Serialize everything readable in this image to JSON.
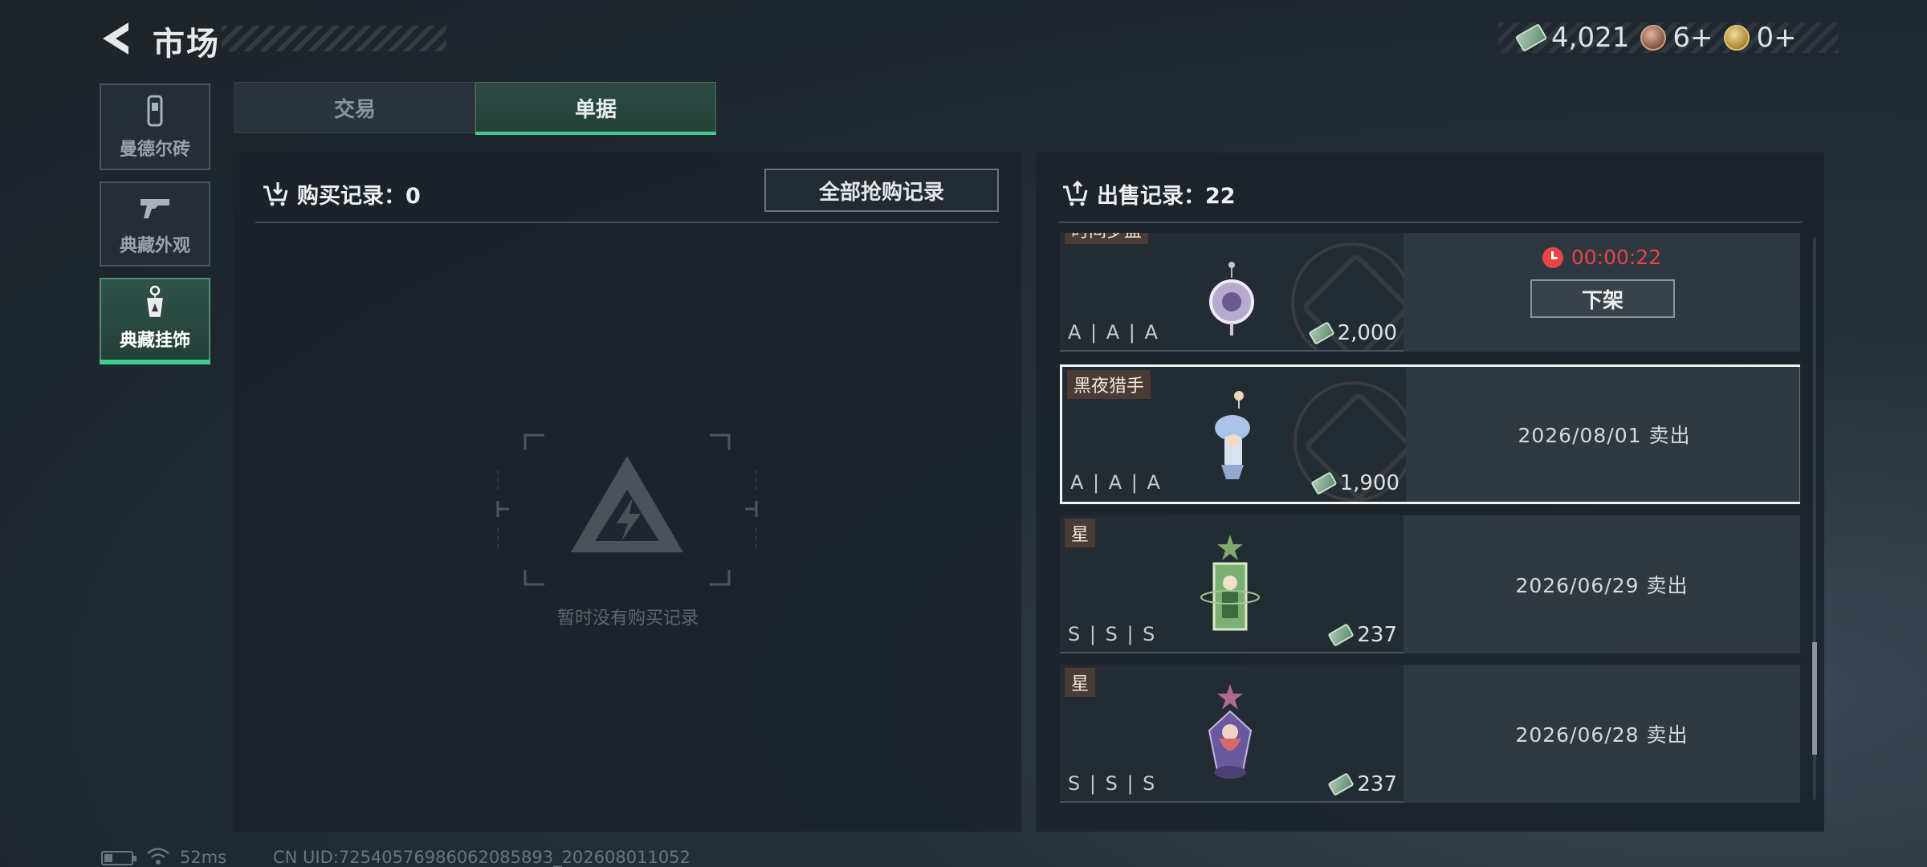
{
  "header": {
    "title": "市场",
    "currencies": [
      {
        "icon": "banknote-icon",
        "value": "4,021"
      },
      {
        "icon": "bronze-coin-icon",
        "value": "6+"
      },
      {
        "icon": "gold-coin-icon",
        "value": "0+"
      }
    ]
  },
  "sidebar": {
    "items": [
      {
        "label": "曼德尔砖",
        "icon": "mandel-brick-icon",
        "active": false
      },
      {
        "label": "典藏外观",
        "icon": "pistol-icon",
        "active": false
      },
      {
        "label": "典藏挂饰",
        "icon": "charm-icon",
        "active": true
      }
    ]
  },
  "tabs": [
    {
      "label": "交易",
      "active": false
    },
    {
      "label": "单据",
      "active": true
    }
  ],
  "purchase": {
    "title": "购买记录：0",
    "all_records_button": "全部抢购记录",
    "empty_text": "暂时没有购买记录"
  },
  "sales": {
    "title": "出售记录：22",
    "records": [
      {
        "tag": "时间罗盘",
        "grade": "A | A | A",
        "price": "2,000",
        "status": "timer",
        "timer": "00:00:22",
        "action": "下架",
        "selected": false
      },
      {
        "tag": "黑夜猎手",
        "grade": "A | A | A",
        "price": "1,900",
        "status": "sold",
        "sold_text": "2026/08/01 卖出",
        "selected": true
      },
      {
        "tag": "星",
        "grade": "S | S | S",
        "price": "237",
        "status": "sold",
        "sold_text": "2026/06/29 卖出",
        "selected": false
      },
      {
        "tag": "星",
        "grade": "S | S | S",
        "price": "237",
        "status": "sold",
        "sold_text": "2026/06/28 卖出",
        "selected": false
      }
    ]
  },
  "status_bar": {
    "ping": "52ms",
    "uid": "CN UID:72540576986062085893_202608011052"
  },
  "colors": {
    "accent": "#3ecf8e",
    "timer": "#e84545",
    "tag_bg": "#4a3c35"
  }
}
